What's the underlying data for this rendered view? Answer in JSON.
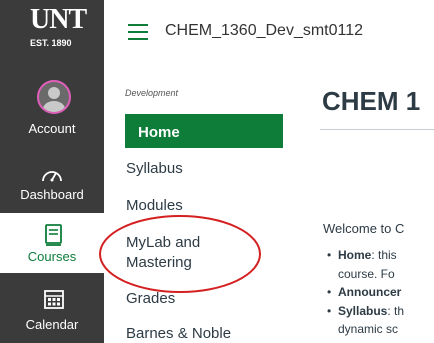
{
  "global_nav": {
    "logo": {
      "main": "UNT",
      "sub": "EST. 1890"
    },
    "items": [
      {
        "label": "Account",
        "icon": "avatar-icon",
        "active": false
      },
      {
        "label": "Dashboard",
        "icon": "dashboard-icon",
        "active": false
      },
      {
        "label": "Courses",
        "icon": "courses-icon",
        "active": true
      },
      {
        "label": "Calendar",
        "icon": "calendar-icon",
        "active": false
      }
    ]
  },
  "header": {
    "course_title": "CHEM_1360_Dev_smt0112"
  },
  "course_nav": {
    "heading": "Development",
    "items": [
      "Home",
      "Syllabus",
      "Modules",
      "MyLab and",
      "Mastering",
      "Grades",
      "Barnes & Noble"
    ]
  },
  "main": {
    "title": "CHEM 1",
    "welcome": "Welcome to C",
    "bullets": [
      {
        "bold": "Home",
        "text": ": this"
      },
      {
        "bold": "",
        "text": "course.  Fo"
      },
      {
        "bold": "Announcer",
        "text": ""
      },
      {
        "bold": "Syllabus",
        "text": ": th"
      },
      {
        "bold": "",
        "text": "dynamic sc"
      }
    ]
  },
  "colors": {
    "accent": "#0e7d3a",
    "nav_bg": "#3b3b3b",
    "annotation": "#d42020"
  }
}
